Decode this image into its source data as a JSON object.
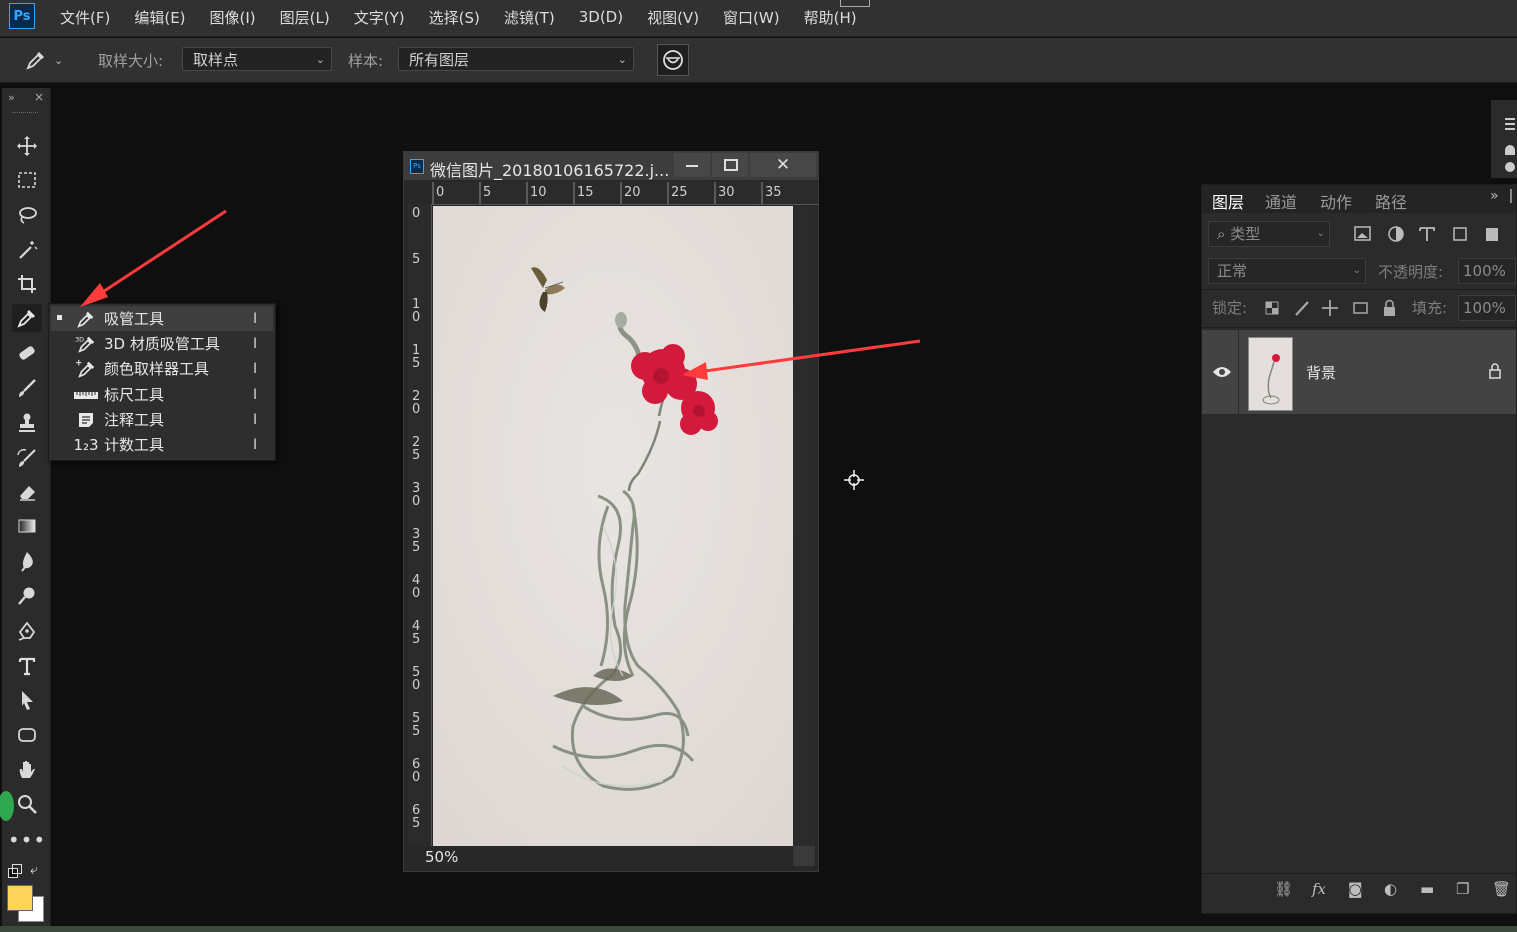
{
  "app": {
    "logo": "Ps",
    "menu": [
      "文件(F)",
      "编辑(E)",
      "图像(I)",
      "图层(L)",
      "文字(Y)",
      "选择(S)",
      "滤镜(T)",
      "3D(D)",
      "视图(V)",
      "窗口(W)",
      "帮助(H)"
    ]
  },
  "options_bar": {
    "tool_icon": "eyedropper-icon",
    "sample_size_label": "取样大小:",
    "sample_size_value": "取样点",
    "sample_label": "样本:",
    "sample_value": "所有图层"
  },
  "toolbar": {
    "tools": [
      "move",
      "marquee",
      "lasso",
      "magic-wand",
      "crop",
      "eyedropper",
      "healing",
      "brush",
      "stamp",
      "history-brush",
      "eraser",
      "gradient",
      "blur",
      "dodge",
      "pen",
      "type",
      "path-select",
      "shape",
      "hand",
      "zoom",
      "more"
    ]
  },
  "flyout": {
    "items": [
      {
        "label": "吸管工具",
        "key": "I",
        "icon": "eyedropper-icon"
      },
      {
        "label": "3D 材质吸管工具",
        "key": "I",
        "icon": "3d-material-eyedropper-icon"
      },
      {
        "label": "颜色取样器工具",
        "key": "I",
        "icon": "color-sampler-icon"
      },
      {
        "label": "标尺工具",
        "key": "I",
        "icon": "ruler-icon"
      },
      {
        "label": "注释工具",
        "key": "I",
        "icon": "note-icon"
      },
      {
        "label": "计数工具",
        "key": "I",
        "icon": "count-icon"
      }
    ],
    "count_glyph": "1₂3"
  },
  "document": {
    "title": "微信图片_20180106165722.j...",
    "zoom": "50%",
    "ruler_top": [
      "0",
      "5",
      "10",
      "15",
      "20",
      "25",
      "30",
      "35"
    ],
    "ruler_left": [
      "0",
      "5",
      "10",
      "15",
      "20",
      "25",
      "30",
      "35",
      "40",
      "45",
      "50",
      "55",
      "60",
      "65"
    ]
  },
  "layers_panel": {
    "tabs": [
      "图层",
      "通道",
      "动作",
      "路径"
    ],
    "filter_placeholder": "类型",
    "blend_mode": "正常",
    "opacity_label": "不透明度:",
    "opacity_value": "100%",
    "lock_label": "锁定:",
    "fill_label": "填充:",
    "fill_value": "100%",
    "layer_name": "背景"
  },
  "colors": {
    "foreground": "#ffd35c",
    "background": "#ffffff",
    "accent": "#31a8ff",
    "annotation_arrow": "#ff3b3b"
  }
}
